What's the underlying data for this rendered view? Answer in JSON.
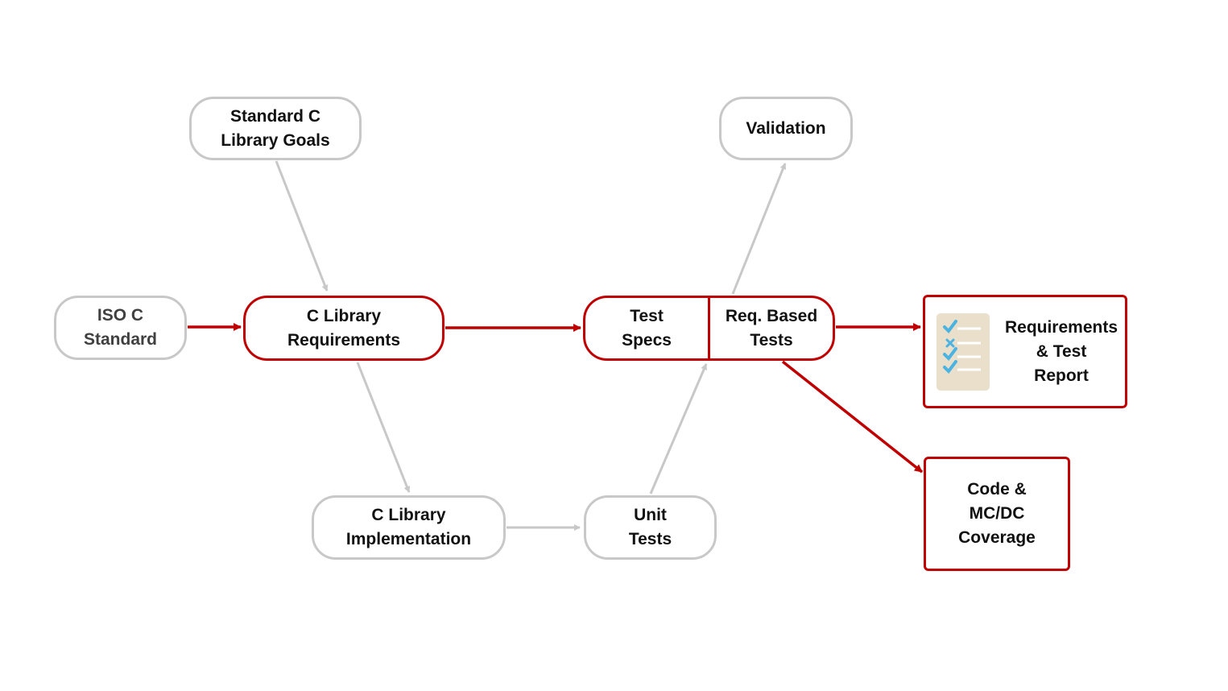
{
  "nodes": {
    "goals": "Standard C\nLibrary Goals",
    "validation": "Validation",
    "iso": "ISO C\nStandard",
    "requirements": "C Library\nRequirements",
    "test_specs": "Test\nSpecs",
    "req_based_tests": "Req. Based\nTests",
    "report": "Requirements\n& Test\nReport",
    "coverage": "Code &\nMC/DC\nCoverage",
    "implementation": "C Library\nImplementation",
    "unit_tests": "Unit\nTests"
  },
  "colors": {
    "accent": "#c00000",
    "neutral": "#c8c8c8",
    "checklist_bg": "#eadfca",
    "check": "#4ab3e2"
  },
  "icons": {
    "report": "checklist-icon"
  }
}
